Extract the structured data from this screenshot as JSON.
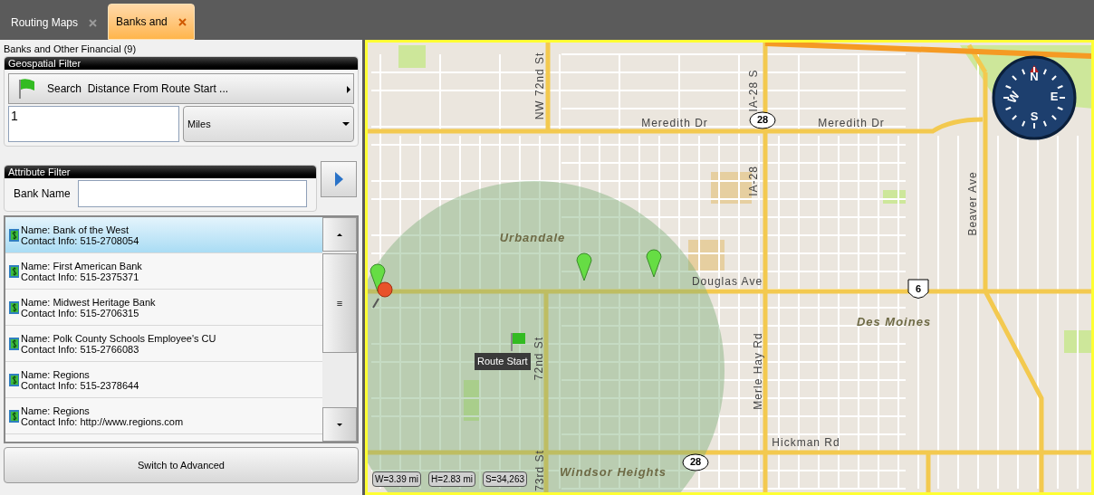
{
  "tabs": [
    {
      "label": "Routing Maps",
      "selected": false
    },
    {
      "label": "Banks and",
      "selected": true
    }
  ],
  "panel": {
    "title": "Banks and Other Financial (9)",
    "geospatial_filter": {
      "header": "Geospatial Filter",
      "search_button": "Search  Distance From Route Start ...",
      "distance": "1",
      "unit": "Miles"
    },
    "attribute_filter": {
      "header": "Attribute Filter",
      "field_label": "Bank Name"
    },
    "results": [
      {
        "name": "Name: Bank of the West",
        "contact": "Contact Info: 515-2708054",
        "selected": true
      },
      {
        "name": "Name: First American Bank",
        "contact": "Contact Info: 515-2375371",
        "selected": false
      },
      {
        "name": "Name: Midwest Heritage Bank",
        "contact": "Contact Info: 515-2706315",
        "selected": false
      },
      {
        "name": "Name: Polk County Schools Employee's CU",
        "contact": "Contact Info: 515-2766083",
        "selected": false
      },
      {
        "name": "Name: Regions",
        "contact": "Contact Info: 515-2378644",
        "selected": false
      },
      {
        "name": "Name: Regions",
        "contact": "Contact Info: http://www.regions.com",
        "selected": false
      }
    ],
    "scroll_grip": "≡",
    "switch_button": "Switch to Advanced"
  },
  "map": {
    "labels": [
      {
        "text": "NW 72nd St",
        "kind": "street"
      },
      {
        "text": "Meredith Dr",
        "kind": "street"
      },
      {
        "text": "28",
        "kind": "state_shield"
      },
      {
        "text": "IA-28 S",
        "kind": "street"
      },
      {
        "text": "Meredith Dr",
        "kind": "street"
      },
      {
        "text": "IA-28",
        "kind": "street"
      },
      {
        "text": "Beaver Ave",
        "kind": "street"
      },
      {
        "text": "Urbandale",
        "kind": "place"
      },
      {
        "text": "Douglas Ave",
        "kind": "street"
      },
      {
        "text": "6",
        "kind": "us_shield"
      },
      {
        "text": "Des Moines",
        "kind": "place"
      },
      {
        "text": "72nd St",
        "kind": "street"
      },
      {
        "text": "Merle Hay Rd",
        "kind": "street"
      },
      {
        "text": "Hickman Rd",
        "kind": "street"
      },
      {
        "text": "28",
        "kind": "state_shield"
      },
      {
        "text": "Windsor Heights",
        "kind": "place"
      },
      {
        "text": "73rd St",
        "kind": "street"
      }
    ],
    "route_start": "Route Start",
    "compass": [
      "N",
      "E",
      "S",
      "W"
    ],
    "scale": [
      "W=3.39 mi",
      "H=2.83 mi",
      "S=34,263"
    ]
  }
}
